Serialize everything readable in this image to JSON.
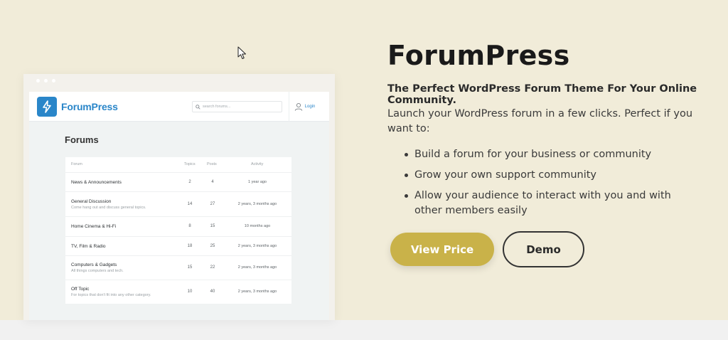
{
  "browser_mock": {
    "logo_text": "ForumPress",
    "search_placeholder": "search forums...",
    "login_label": "Login",
    "forums_heading": "Forums",
    "columns": {
      "forum": "Forum",
      "topics": "Topics",
      "posts": "Posts",
      "activity": "Activity"
    },
    "rows": [
      {
        "name": "News & Announcements",
        "desc": "",
        "topics": "2",
        "posts": "4",
        "activity": "1 year ago"
      },
      {
        "name": "General Discussion",
        "desc": "Come hang out and discuss general topics.",
        "topics": "14",
        "posts": "27",
        "activity": "2 years, 3 months ago"
      },
      {
        "name": "Home Cinema & Hi-Fi",
        "desc": "",
        "topics": "8",
        "posts": "15",
        "activity": "10 months ago"
      },
      {
        "name": "TV, Film & Radio",
        "desc": "",
        "topics": "18",
        "posts": "25",
        "activity": "2 years, 3 months ago"
      },
      {
        "name": "Computers & Gadgets",
        "desc": "All things computers and tech.",
        "topics": "15",
        "posts": "22",
        "activity": "2 years, 3 months ago"
      },
      {
        "name": "Off Topic",
        "desc": "For topics that don't fit into any other category.",
        "topics": "10",
        "posts": "40",
        "activity": "2 years, 3 months ago"
      }
    ]
  },
  "product": {
    "title": "ForumPress",
    "subtitle": "The Perfect WordPress Forum Theme For Your Online Community.",
    "intro": "Launch your WordPress forum in a few clicks. Perfect if you want to:",
    "bullets": [
      "Build a forum for your business or community",
      "Grow your own support community",
      "Allow your audience to interact with you and with other members easily"
    ],
    "view_price_label": "View Price",
    "demo_label": "Demo"
  },
  "colors": {
    "background": "#f1ecd9",
    "accent_gold": "#c9b249",
    "brand_blue": "#2a86c9"
  }
}
